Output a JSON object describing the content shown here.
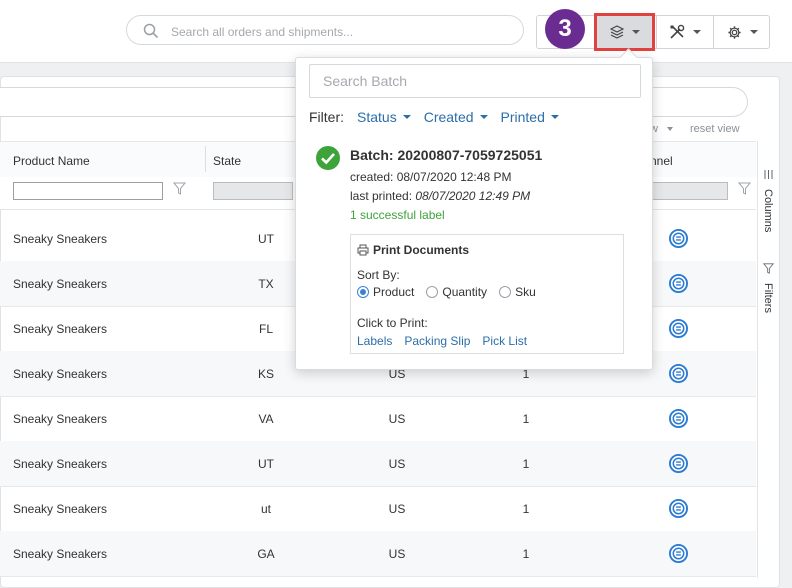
{
  "topbar": {
    "search_placeholder": "Search all orders and shipments...",
    "step_badge": "3",
    "buttons": [
      "batch-stack",
      "tools",
      "settings"
    ]
  },
  "grid": {
    "view_label": "w",
    "reset_view": "reset view",
    "columns": {
      "product_name": "Product Name",
      "state": "State",
      "channel": "nnel"
    },
    "rows": [
      {
        "name": "Sneaky Sneakers",
        "state": "UT",
        "country": "",
        "qty": ""
      },
      {
        "name": "Sneaky Sneakers",
        "state": "TX",
        "country": "",
        "qty": ""
      },
      {
        "name": "Sneaky Sneakers",
        "state": "FL",
        "country": "",
        "qty": ""
      },
      {
        "name": "Sneaky Sneakers",
        "state": "KS",
        "country": "US",
        "qty": "1"
      },
      {
        "name": "Sneaky Sneakers",
        "state": "VA",
        "country": "US",
        "qty": "1"
      },
      {
        "name": "Sneaky Sneakers",
        "state": "UT",
        "country": "US",
        "qty": "1"
      },
      {
        "name": "Sneaky Sneakers",
        "state": "ut",
        "country": "US",
        "qty": "1"
      },
      {
        "name": "Sneaky Sneakers",
        "state": "GA",
        "country": "US",
        "qty": "1"
      }
    ],
    "sidebar": {
      "columns": "Columns",
      "filters": "Filters"
    }
  },
  "batch_dropdown": {
    "search_placeholder": "Search Batch",
    "filter_label": "Filter:",
    "filters": [
      "Status",
      "Created",
      "Printed"
    ],
    "batch": {
      "title": "Batch: 20200807-7059725051",
      "created": "created: 08/07/2020 12:48 PM",
      "last_printed_label": "last printed: ",
      "last_printed_value": "08/07/2020 12:49 PM",
      "success_text": "1 successful label"
    },
    "print_documents": {
      "title": "Print Documents",
      "sort_by": "Sort By:",
      "sort_options": [
        "Product",
        "Quantity",
        "Sku"
      ],
      "selected_sort": "Product",
      "click_to_print": "Click to Print:",
      "links": [
        "Labels",
        "Packing Slip",
        "Pick List"
      ]
    }
  },
  "colors": {
    "accent_link": "#2c6ea8",
    "badge": "#6a2c91",
    "highlight_border": "#e0423f",
    "success": "#3fa33b"
  }
}
